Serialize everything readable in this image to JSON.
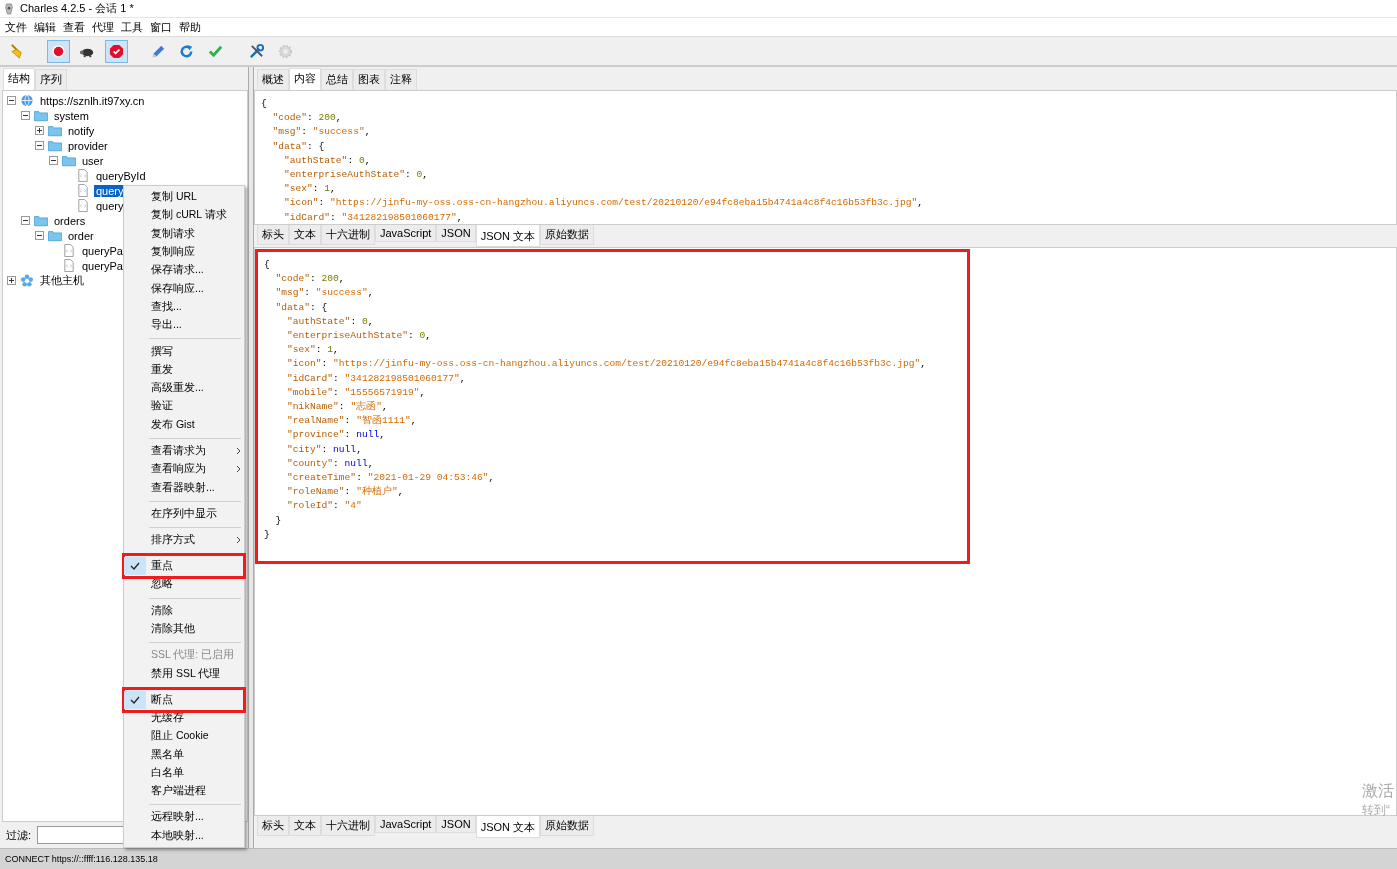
{
  "window": {
    "title": "Charles 4.2.5 - 会话 1 *"
  },
  "menu_bar": [
    "文件",
    "编辑",
    "查看",
    "代理",
    "工具",
    "窗口",
    "帮助"
  ],
  "toolbar": [
    {
      "pressed": false,
      "disabled": false
    },
    {
      "pressed": true,
      "disabled": false
    },
    {
      "pressed": false,
      "disabled": false
    },
    {
      "pressed": true,
      "disabled": false
    },
    {
      "pressed": false,
      "disabled": false
    },
    {
      "pressed": false,
      "disabled": false
    },
    {
      "pressed": false,
      "disabled": false
    },
    {
      "pressed": false,
      "disabled": false
    },
    {
      "pressed": false,
      "disabled": true
    }
  ],
  "left_tabs": [
    {
      "label": "结构",
      "selected": true
    },
    {
      "label": "序列",
      "selected": false
    }
  ],
  "tree": [
    {
      "label": "https://sznlh.it97xy.cn",
      "kind": "host",
      "expanded": true,
      "selected": false,
      "children": [
        {
          "label": "system",
          "kind": "folder",
          "expanded": true,
          "selected": false,
          "children": [
            {
              "label": "notify",
              "kind": "folder",
              "expanded": false,
              "selected": false
            },
            {
              "label": "provider",
              "kind": "folder",
              "expanded": true,
              "selected": false,
              "children": [
                {
                  "label": "user",
                  "kind": "folder",
                  "expanded": true,
                  "selected": false,
                  "children": [
                    {
                      "label": "queryById",
                      "kind": "request",
                      "selected": false
                    },
                    {
                      "label": "query",
                      "kind": "request",
                      "selected": true
                    },
                    {
                      "label": "query",
                      "kind": "request",
                      "selected": false
                    }
                  ]
                }
              ]
            }
          ]
        },
        {
          "label": "orders",
          "kind": "folder",
          "expanded": true,
          "selected": false,
          "children": [
            {
              "label": "order",
              "kind": "folder",
              "expanded": true,
              "selected": false,
              "children": [
                {
                  "label": "queryPa",
                  "kind": "request",
                  "selected": false
                },
                {
                  "label": "queryPa",
                  "kind": "request",
                  "selected": false
                }
              ]
            }
          ]
        }
      ]
    },
    {
      "label": "其他主机",
      "kind": "hosts",
      "expanded": false,
      "selected": false
    }
  ],
  "filter": {
    "label": "过滤:"
  },
  "right_tabs": [
    {
      "label": "概述",
      "selected": false
    },
    {
      "label": "内容",
      "selected": true
    },
    {
      "label": "总结",
      "selected": false
    },
    {
      "label": "图表",
      "selected": false
    },
    {
      "label": "注释",
      "selected": false
    }
  ],
  "request_body": {
    "highlighted": false,
    "lines": [
      "{",
      "  \"code\": 200,",
      "  \"msg\": \"success\",",
      "  \"data\": {",
      "    \"authState\": 0,",
      "    \"enterpriseAuthState\": 0,",
      "    \"sex\": 1,",
      "    \"icon\": \"https://jinfu-my-oss.oss-cn-hangzhou.aliyuncs.com/test/20210120/e94fc8eba15b4741a4c8f4c16b53fb3c.jpg\",",
      "    \"idCard\": \"341282198501060177\","
    ]
  },
  "upper_subtabs": [
    {
      "label": "标头",
      "selected": false
    },
    {
      "label": "文本",
      "selected": false
    },
    {
      "label": "十六进制",
      "selected": false
    },
    {
      "label": "JavaScript",
      "selected": false
    },
    {
      "label": "JSON",
      "selected": false
    },
    {
      "label": "JSON 文本",
      "selected": true
    },
    {
      "label": "原始数据",
      "selected": false
    }
  ],
  "response_body": {
    "highlighted": true,
    "lines": [
      "{",
      "  \"code\": 200,",
      "  \"msg\": \"success\",",
      "  \"data\": {",
      "    \"authState\": 0,",
      "    \"enterpriseAuthState\": 0,",
      "    \"sex\": 1,",
      "    \"icon\": \"https://jinfu-my-oss.oss-cn-hangzhou.aliyuncs.com/test/20210120/e94fc8eba15b4741a4c8f4c16b53fb3c.jpg\",",
      "    \"idCard\": \"341282198501060177\",",
      "    \"mobile\": \"15556571919\",",
      "    \"nikName\": \"志函\",",
      "    \"realName\": \"智函1111\",",
      "    \"province\": null,",
      "    \"city\": null,",
      "    \"county\": null,",
      "    \"createTime\": \"2021-01-29 04:53:46\",",
      "    \"roleName\": \"种植户\",",
      "    \"roleId\": \"4\"",
      "  }",
      "}"
    ]
  },
  "lower_subtabs": [
    {
      "label": "标头",
      "selected": false
    },
    {
      "label": "文本",
      "selected": false
    },
    {
      "label": "十六进制",
      "selected": false
    },
    {
      "label": "JavaScript",
      "selected": false
    },
    {
      "label": "JSON",
      "selected": false
    },
    {
      "label": "JSON 文本",
      "selected": true
    },
    {
      "label": "原始数据",
      "selected": false
    }
  ],
  "context_menu": [
    {
      "kind": "item",
      "label": "复制 URL",
      "checked": false,
      "disabled": false,
      "submenu": false,
      "highlighted": false
    },
    {
      "kind": "item",
      "label": "复制 cURL 请求",
      "checked": false,
      "disabled": false,
      "submenu": false,
      "highlighted": false
    },
    {
      "kind": "item",
      "label": "复制请求",
      "checked": false,
      "disabled": false,
      "submenu": false,
      "highlighted": false
    },
    {
      "kind": "item",
      "label": "复制响应",
      "checked": false,
      "disabled": false,
      "submenu": false,
      "highlighted": false
    },
    {
      "kind": "item",
      "label": "保存请求...",
      "checked": false,
      "disabled": false,
      "submenu": false,
      "highlighted": false
    },
    {
      "kind": "item",
      "label": "保存响应...",
      "checked": false,
      "disabled": false,
      "submenu": false,
      "highlighted": false
    },
    {
      "kind": "item",
      "label": "查找...",
      "checked": false,
      "disabled": false,
      "submenu": false,
      "highlighted": false
    },
    {
      "kind": "item",
      "label": "导出...",
      "checked": false,
      "disabled": false,
      "submenu": false,
      "highlighted": false
    },
    {
      "kind": "separator"
    },
    {
      "kind": "item",
      "label": "撰写",
      "checked": false,
      "disabled": false,
      "submenu": false,
      "highlighted": false
    },
    {
      "kind": "item",
      "label": "重发",
      "checked": false,
      "disabled": false,
      "submenu": false,
      "highlighted": false
    },
    {
      "kind": "item",
      "label": "高级重发...",
      "checked": false,
      "disabled": false,
      "submenu": false,
      "highlighted": false
    },
    {
      "kind": "item",
      "label": "验证",
      "checked": false,
      "disabled": false,
      "submenu": false,
      "highlighted": false
    },
    {
      "kind": "item",
      "label": "发布 Gist",
      "checked": false,
      "disabled": false,
      "submenu": false,
      "highlighted": false
    },
    {
      "kind": "separator"
    },
    {
      "kind": "item",
      "label": "查看请求为",
      "checked": false,
      "disabled": false,
      "submenu": true,
      "highlighted": false
    },
    {
      "kind": "item",
      "label": "查看响应为",
      "checked": false,
      "disabled": false,
      "submenu": true,
      "highlighted": false
    },
    {
      "kind": "item",
      "label": "查看器映射...",
      "checked": false,
      "disabled": false,
      "submenu": false,
      "highlighted": false
    },
    {
      "kind": "separator"
    },
    {
      "kind": "item",
      "label": "在序列中显示",
      "checked": false,
      "disabled": false,
      "submenu": false,
      "highlighted": false
    },
    {
      "kind": "separator"
    },
    {
      "kind": "item",
      "label": "排序方式",
      "checked": false,
      "disabled": false,
      "submenu": true,
      "highlighted": false
    },
    {
      "kind": "separator"
    },
    {
      "kind": "item",
      "label": "重点",
      "checked": true,
      "disabled": false,
      "submenu": false,
      "highlighted": true
    },
    {
      "kind": "item",
      "label": "忽略",
      "checked": false,
      "disabled": false,
      "submenu": false,
      "highlighted": false
    },
    {
      "kind": "separator"
    },
    {
      "kind": "item",
      "label": "清除",
      "checked": false,
      "disabled": false,
      "submenu": false,
      "highlighted": false
    },
    {
      "kind": "item",
      "label": "清除其他",
      "checked": false,
      "disabled": false,
      "submenu": false,
      "highlighted": false
    },
    {
      "kind": "separator"
    },
    {
      "kind": "item",
      "label": "SSL 代理: 已启用",
      "checked": false,
      "disabled": true,
      "submenu": false,
      "highlighted": false
    },
    {
      "kind": "item",
      "label": "禁用 SSL 代理",
      "checked": false,
      "disabled": false,
      "submenu": false,
      "highlighted": false
    },
    {
      "kind": "separator"
    },
    {
      "kind": "item",
      "label": "断点",
      "checked": true,
      "disabled": false,
      "submenu": false,
      "highlighted": true
    },
    {
      "kind": "item",
      "label": "无缓存",
      "checked": false,
      "disabled": false,
      "submenu": false,
      "highlighted": false
    },
    {
      "kind": "item",
      "label": "阻止 Cookie",
      "checked": false,
      "disabled": false,
      "submenu": false,
      "highlighted": false
    },
    {
      "kind": "item",
      "label": "黑名单",
      "checked": false,
      "disabled": false,
      "submenu": false,
      "highlighted": false
    },
    {
      "kind": "item",
      "label": "白名单",
      "checked": false,
      "disabled": false,
      "submenu": false,
      "highlighted": false
    },
    {
      "kind": "item",
      "label": "客户端进程",
      "checked": false,
      "disabled": false,
      "submenu": false,
      "highlighted": false
    },
    {
      "kind": "separator"
    },
    {
      "kind": "item",
      "label": "远程映射...",
      "checked": false,
      "disabled": false,
      "submenu": false,
      "highlighted": false
    },
    {
      "kind": "item",
      "label": "本地映射...",
      "checked": false,
      "disabled": false,
      "submenu": false,
      "highlighted": false
    }
  ],
  "activation_notice": [
    "激活",
    "转到“"
  ],
  "status_bar": "CONNECT https://::ffff:116.128.135.18"
}
